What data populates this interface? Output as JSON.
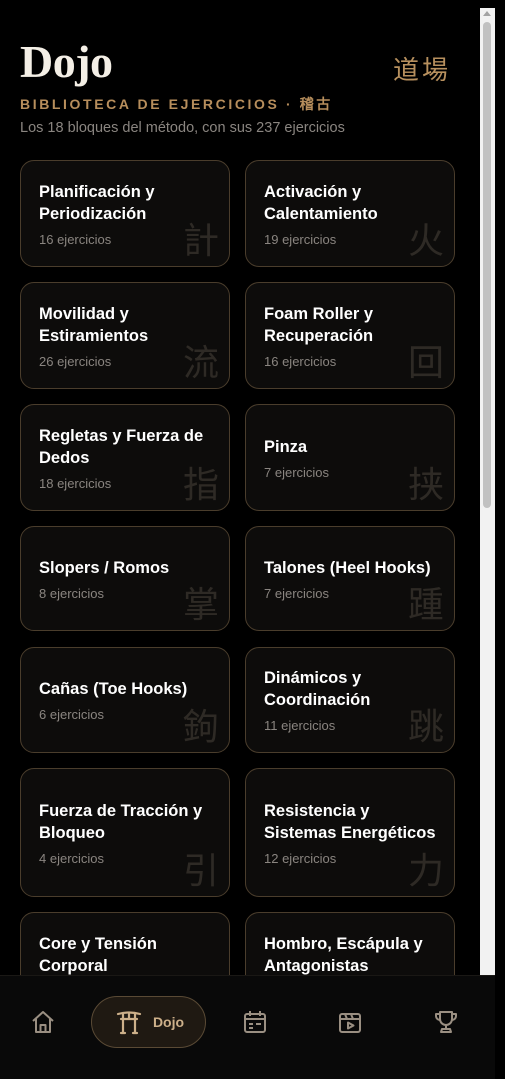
{
  "header": {
    "title": "Dojo",
    "kanji": "道場",
    "subtitle": "BIBLIOTECA DE EJERCICIOS · 稽古",
    "description": "Los 18 bloques del método, con sus 237 ejercicios"
  },
  "blocks": [
    {
      "name": "Planificación y Periodización",
      "count": "16 ejercicios",
      "glyph": "計"
    },
    {
      "name": "Activación y Calentamiento",
      "count": "19 ejercicios",
      "glyph": "火"
    },
    {
      "name": "Movilidad y Estiramientos",
      "count": "26 ejercicios",
      "glyph": "流"
    },
    {
      "name": "Foam Roller y Recuperación",
      "count": "16 ejercicios",
      "glyph": "回"
    },
    {
      "name": "Regletas y Fuerza de Dedos",
      "count": "18 ejercicios",
      "glyph": "指"
    },
    {
      "name": "Pinza",
      "count": "7 ejercicios",
      "glyph": "挟"
    },
    {
      "name": "Slopers / Romos",
      "count": "8 ejercicios",
      "glyph": "掌"
    },
    {
      "name": "Talones (Heel Hooks)",
      "count": "7 ejercicios",
      "glyph": "踵"
    },
    {
      "name": "Cañas (Toe Hooks)",
      "count": "6 ejercicios",
      "glyph": "鉤"
    },
    {
      "name": "Dinámicos y Coordinación",
      "count": "11 ejercicios",
      "glyph": "跳"
    },
    {
      "name": "Fuerza de Tracción y Bloqueo",
      "count": "4 ejercicios",
      "glyph": "引"
    },
    {
      "name": "Resistencia y Sistemas Energéticos",
      "count": "12 ejercicios",
      "glyph": "力"
    },
    {
      "name": "Core y Tensión Corporal",
      "count": "",
      "glyph": ""
    },
    {
      "name": "Hombro, Escápula y Antagonistas",
      "count": "",
      "glyph": ""
    }
  ],
  "nav": {
    "active_label": "Dojo",
    "items": [
      "home-icon",
      "torii-icon",
      "calendar-icon",
      "video-icon",
      "trophy-icon"
    ]
  },
  "colors": {
    "accent": "#b78e5c",
    "card_border": "#4a3d2c",
    "background": "#000000"
  }
}
